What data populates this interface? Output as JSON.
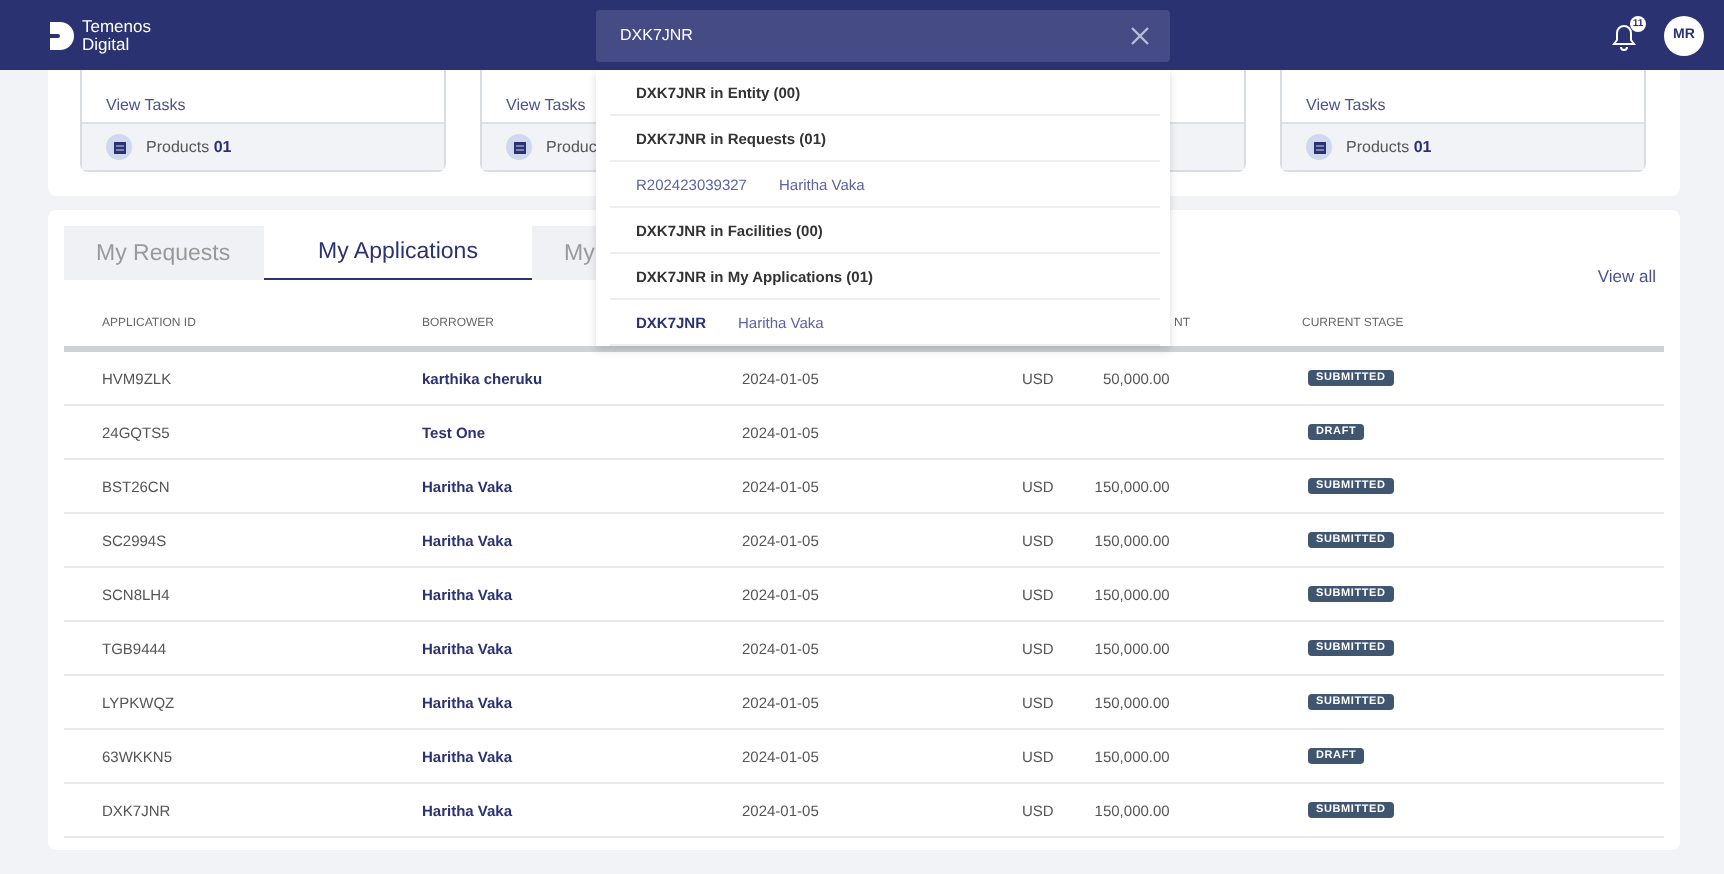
{
  "header": {
    "logo_lines": [
      "Temenos",
      "Digital"
    ],
    "search_value": "DXK7JNR",
    "notification_count": "11",
    "avatar": "MR"
  },
  "search_results": [
    {
      "heading": "DXK7JNR in Entity (00)"
    },
    {
      "heading": "DXK7JNR in Requests (01)",
      "results": [
        {
          "kind": "request",
          "id": "R202423039327",
          "name": "Haritha Vaka"
        }
      ]
    },
    {
      "heading": "DXK7JNR in Facilities (00)"
    },
    {
      "heading": "DXK7JNR in My Applications (01)",
      "results": [
        {
          "kind": "application",
          "id": "DXK7JNR",
          "name": "Haritha Vaka"
        }
      ]
    }
  ],
  "cards": [
    {
      "kind": "card",
      "view_tasks": "View Tasks",
      "products_label": "Products",
      "products_count": "01"
    },
    {
      "kind": "card",
      "view_tasks": "View Tasks",
      "products_label": "Produc"
    },
    {
      "kind": "covered"
    },
    {
      "kind": "card",
      "view_tasks": "View Tasks",
      "products_label": "Products",
      "products_count": "01"
    }
  ],
  "tabs": [
    {
      "label": "My Requests",
      "selected": false
    },
    {
      "label": "My Applications",
      "selected": true
    },
    {
      "label": "My",
      "selected": false
    }
  ],
  "view_all": "View all",
  "table": {
    "columns": [
      "APPLICATION ID",
      "BORROWER",
      "",
      "NT",
      "CURRENT STAGE"
    ],
    "rows": [
      {
        "id": "HVM9ZLK",
        "borrower": "karthika cheruku",
        "date": "2024-01-05",
        "currency": "USD",
        "amount": "50,000.00",
        "stage": "SUBMITTED"
      },
      {
        "id": "24GQTS5",
        "borrower": "Test One",
        "date": "2024-01-05",
        "stage": "DRAFT"
      },
      {
        "id": "BST26CN",
        "borrower": "Haritha Vaka",
        "date": "2024-01-05",
        "currency": "USD",
        "amount": "150,000.00",
        "stage": "SUBMITTED"
      },
      {
        "id": "SC2994S",
        "borrower": "Haritha Vaka",
        "date": "2024-01-05",
        "currency": "USD",
        "amount": "150,000.00",
        "stage": "SUBMITTED"
      },
      {
        "id": "SCN8LH4",
        "borrower": "Haritha Vaka",
        "date": "2024-01-05",
        "currency": "USD",
        "amount": "150,000.00",
        "stage": "SUBMITTED"
      },
      {
        "id": "TGB9444",
        "borrower": "Haritha Vaka",
        "date": "2024-01-05",
        "currency": "USD",
        "amount": "150,000.00",
        "stage": "SUBMITTED"
      },
      {
        "id": "LYPKWQZ",
        "borrower": "Haritha Vaka",
        "date": "2024-01-05",
        "currency": "USD",
        "amount": "150,000.00",
        "stage": "SUBMITTED"
      },
      {
        "id": "63WKKN5",
        "borrower": "Haritha Vaka",
        "date": "2024-01-05",
        "currency": "USD",
        "amount": "150,000.00",
        "stage": "DRAFT"
      },
      {
        "id": "DXK7JNR",
        "borrower": "Haritha Vaka",
        "date": "2024-01-05",
        "currency": "USD",
        "amount": "150,000.00",
        "stage": "SUBMITTED"
      }
    ]
  }
}
